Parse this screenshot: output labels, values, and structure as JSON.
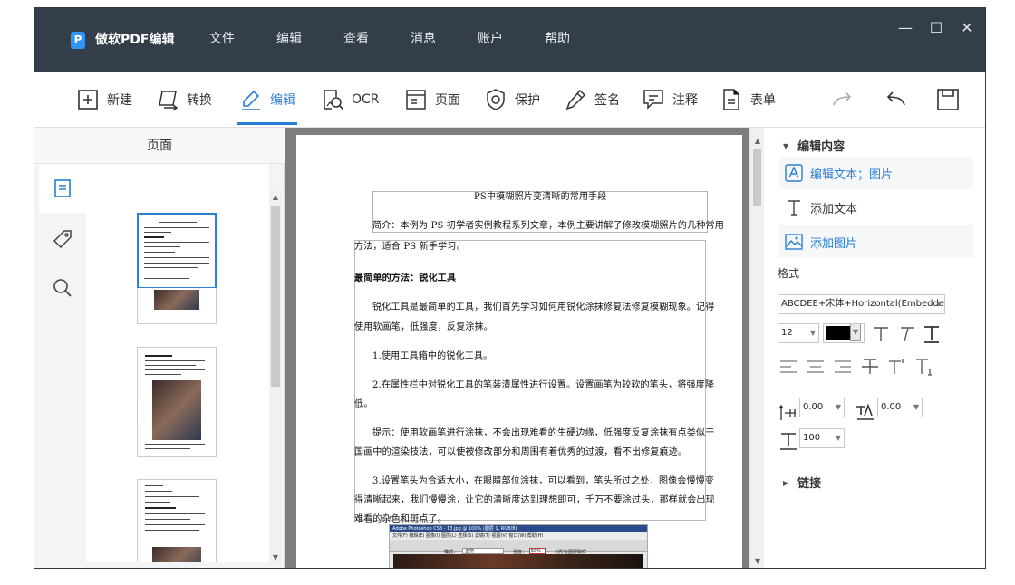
{
  "app": {
    "title": "傲软PDF编辑",
    "logo_letter": "P"
  },
  "menu": [
    "文件",
    "编辑",
    "查看",
    "消息",
    "账户",
    "帮助"
  ],
  "window_controls": {
    "minimize": "—",
    "maximize": "☐",
    "close": "✕"
  },
  "toolbar": {
    "new": "新建",
    "convert": "转换",
    "edit": "编辑",
    "ocr": "OCR",
    "page": "页面",
    "protect": "保护",
    "sign": "签名",
    "annotate": "注释",
    "form": "表单"
  },
  "left_panel": {
    "title": "页面"
  },
  "document": {
    "title": "PS中模糊照片变清晰的常用手段",
    "intro_line1": "简介：本例为 PS 初学者实例教程系列文章，本例主要讲解了修改模糊照片的几种常用",
    "intro_line2": "方法，适合 PS 新手学习。",
    "heading": "最简单的方法：锐化工具",
    "p1_line1": "锐化工具是最简单的工具，我们首先学习如何用锐化涂抹修复法修复模糊现象。记得",
    "p1_line2": "使用软画笔，低强度，反复涂抹。",
    "step1": "1.使用工具箱中的锐化工具。",
    "step2_line1": "2.在属性栏中对锐化工具的笔装潢属性进行设置。设置画笔为较软的笔头，将强度降",
    "step2_line2": "低。",
    "tip_line1": "提示：使用软画笔进行涂抹，不会出现难看的生硬边缘，低强度反复涂抹有点类似于",
    "tip_line2": "国画中的渲染技法，可以使被修改部分和周围有着优秀的过渡，看不出修复痕迹。",
    "step3_line1": "3.设置笔头为合适大小，在眼睛部位涂抹，可以看到，笔头所过之处，图像会慢慢变",
    "step3_line2": "得清晰起来，我们慢慢涂，让它的清晰度达到理想即可，千万不要涂过头，那样就会出现",
    "step3_line3": "难看的杂色和斑点了。",
    "embedded_image": {
      "title": "Adobe Photoshop CS3 - 13.jpg @ 100% (图层 1, RGB/8)",
      "menu": "文件(F) 编辑(E) 图像(I) 图层(L) 选择(S) 滤镜(T) 视图(V) 窗口(W) 帮助(H)",
      "option_mode_label": "模式：",
      "option_mode_value": "正常",
      "option_strength_label": "强度：",
      "option_strength_value": "50%",
      "option_checkbox": "对所有图层取样"
    }
  },
  "right_panel": {
    "edit_content": "编辑内容",
    "edit_text_image": "编辑文本；图片",
    "add_text": "添加文本",
    "add_image": "添加图片",
    "format_label": "格式",
    "font_value": "ABCDEE+宋体+Horizontal(Embedded",
    "font_size": "12",
    "char_spacing": "0.00",
    "word_spacing": "0.00",
    "scale": "100",
    "links": "链接",
    "text_color": "#000000",
    "accent": "#2a7fd4"
  }
}
